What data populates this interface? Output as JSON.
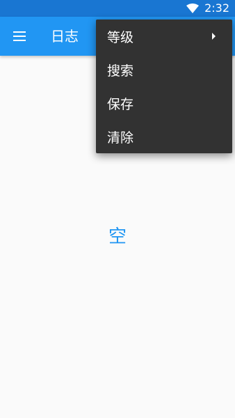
{
  "status_bar": {
    "time": "2:32",
    "wifi_icon": "wifi-icon"
  },
  "app_bar": {
    "menu_icon": "hamburger-menu-icon",
    "title": "日志",
    "color": "#2196f3"
  },
  "overflow_menu": {
    "items": [
      {
        "label": "等级",
        "has_submenu": true
      },
      {
        "label": "搜索",
        "has_submenu": false
      },
      {
        "label": "保存",
        "has_submenu": false
      },
      {
        "label": "清除",
        "has_submenu": false
      }
    ]
  },
  "content": {
    "empty_label": "空"
  },
  "colors": {
    "status_bar": "#1976d2",
    "app_bar": "#2196f3",
    "menu_background": "#323232",
    "accent": "#2196f3",
    "background": "#fafafa"
  }
}
